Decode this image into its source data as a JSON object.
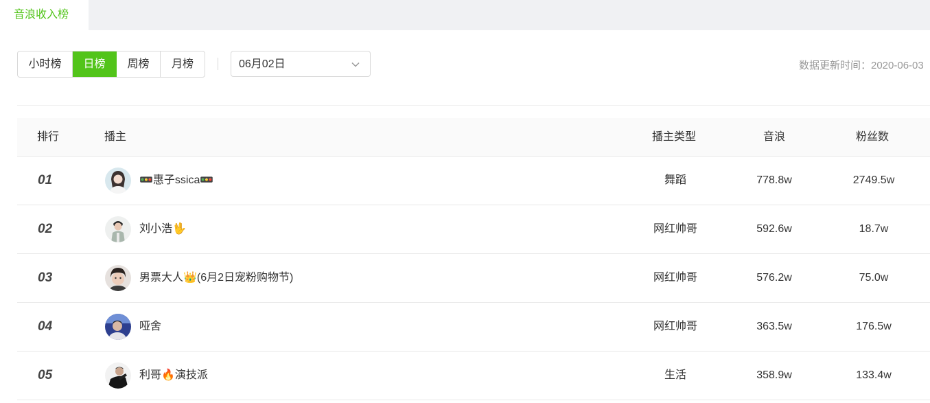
{
  "tabs": {
    "active": "音浪收入榜"
  },
  "period_tabs": [
    "小时榜",
    "日榜",
    "周榜",
    "月榜"
  ],
  "active_period": "日榜",
  "date_select": {
    "value": "06月02日"
  },
  "update_time": "数据更新时间：2020-06-03",
  "table": {
    "headers": {
      "rank": "排行",
      "streamer": "播主",
      "type": "播主类型",
      "sound": "音浪",
      "fans": "粉丝数"
    },
    "rows": [
      {
        "rank": "01",
        "name": "🚥惠子ssica🚥",
        "type": "舞蹈",
        "sound": "778.8w",
        "fans": "2749.5w"
      },
      {
        "rank": "02",
        "name": "刘小浩🖖",
        "type": "网红帅哥",
        "sound": "592.6w",
        "fans": "18.7w"
      },
      {
        "rank": "03",
        "name": "男票大人👑(6月2日宠粉购物节)",
        "type": "网红帅哥",
        "sound": "576.2w",
        "fans": "75.0w"
      },
      {
        "rank": "04",
        "name": "哑舍",
        "type": "网红帅哥",
        "sound": "363.5w",
        "fans": "176.5w"
      },
      {
        "rank": "05",
        "name": "利哥🔥演技派",
        "type": "生活",
        "sound": "358.9w",
        "fans": "133.4w"
      }
    ]
  },
  "colors": {
    "accent": "#52c41a",
    "header_bg": "#fafafa",
    "tabbar_bg": "#f0f1f3"
  }
}
